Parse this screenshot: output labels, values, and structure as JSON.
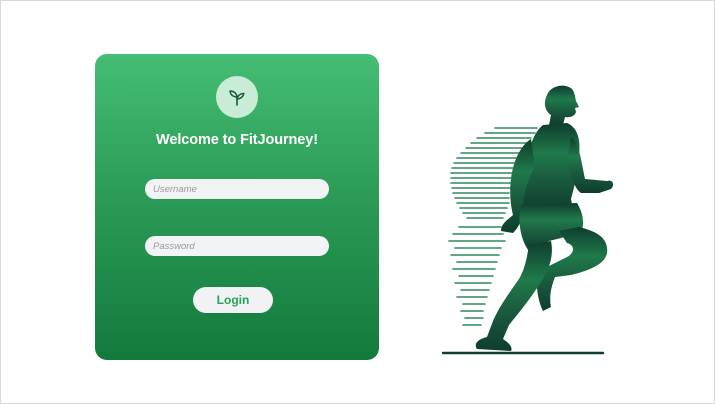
{
  "login": {
    "logo_icon": "sprout-leaf-icon",
    "welcome_text": "Welcome to FitJourney!",
    "username_placeholder": "Username",
    "password_placeholder": "Password",
    "login_label": "Login"
  },
  "illustration": {
    "icon": "running-man-icon"
  },
  "colors": {
    "card_top": "#45bd74",
    "card_bottom": "#137a3c",
    "button_text": "#24a35a",
    "runner_dark": "#0f3d2e",
    "runner_light": "#3aa466"
  }
}
